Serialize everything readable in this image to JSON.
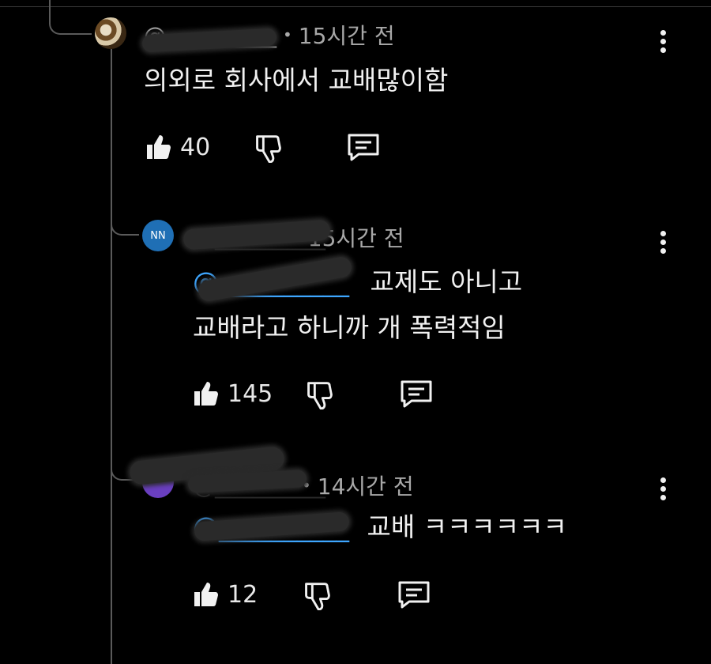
{
  "comments": [
    {
      "handle": "@__________",
      "time": "15시간 전",
      "mention": "",
      "lines": [
        "의외로 회사에서 교배많이함"
      ],
      "likes": "40",
      "avatar": {
        "initials": "",
        "color": "#8a6a3a"
      }
    },
    {
      "handle": "@__________",
      "time": "15시간 전",
      "mention": "@__________",
      "lines": [
        "교제도 아니고",
        "교배라고 하니까 개 폭력적임"
      ],
      "likes": "145",
      "avatar": {
        "initials": "NN",
        "color": "#1f6fb5"
      }
    },
    {
      "handle": "@__________",
      "time": "14시간 전",
      "mention": "@__________",
      "lines": [
        "교배 ㅋㅋㅋㅋㅋㅋ"
      ],
      "likes": "12",
      "avatar": {
        "initials": "",
        "color": "#6a3fc0"
      }
    }
  ],
  "icons": {
    "like": "thumbs-up-icon",
    "dislike": "thumbs-down-icon",
    "reply": "reply-icon",
    "menu": "more-vertical-icon"
  }
}
